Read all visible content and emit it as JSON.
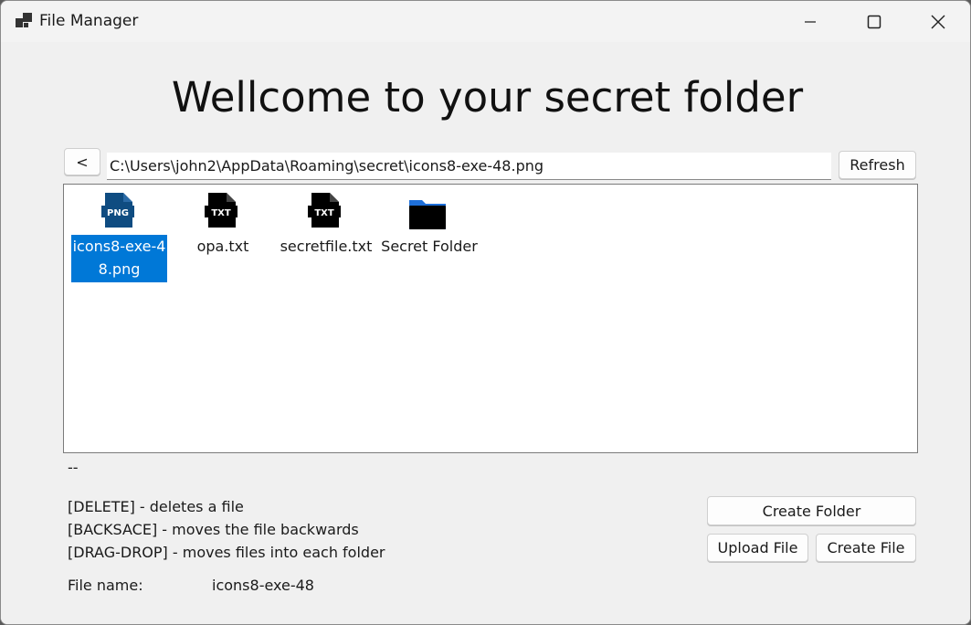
{
  "window": {
    "title": "File Manager",
    "app_icon": "app-window-icon",
    "controls": [
      "minimize-icon",
      "maximize-icon",
      "close-icon"
    ]
  },
  "heading": "Wellcome to your secret folder",
  "nav": {
    "back_label": "<",
    "path_value": "C:\\Users\\john2\\AppData\\Roaming\\secret\\icons8-exe-48.png",
    "refresh_label": "Refresh"
  },
  "files": [
    {
      "name_line1": "icons8-exe-4",
      "name_line2": "8.png",
      "type": "png",
      "icon": "png-file-icon",
      "selected": true
    },
    {
      "name_line1": "opa.txt",
      "type": "txt",
      "icon": "txt-file-icon",
      "selected": false
    },
    {
      "name_line1": "secretfile.txt",
      "type": "txt",
      "icon": "txt-file-icon",
      "selected": false
    },
    {
      "name_line1": "Secret Folder",
      "type": "folder",
      "icon": "folder-icon",
      "selected": false
    }
  ],
  "status": "--",
  "help": {
    "line1": "[DELETE] - deletes a file",
    "line2": "[BACKSACE] - moves the file backwards",
    "line3": "[DRAG-DROP] - moves files into each folder"
  },
  "actions": {
    "create_folder": "Create Folder",
    "upload_file": "Upload File",
    "create_file": "Create File"
  },
  "file_name": {
    "label": "File name:",
    "value": "icons8-exe-48"
  },
  "colors": {
    "selection": "#0078d7",
    "png_icon": "#0f4c81",
    "folder_tab": "#1e6fd9"
  }
}
